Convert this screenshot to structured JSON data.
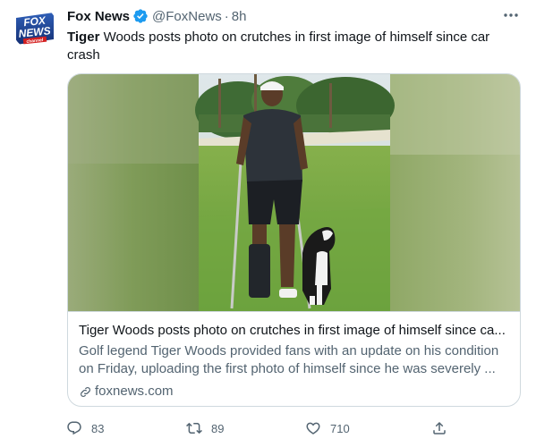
{
  "account": {
    "display_name": "Fox News",
    "handle": "@FoxNews",
    "separator": "·",
    "time": "8h",
    "avatar_text_line1": "FOX",
    "avatar_text_line2": "NEWS",
    "avatar_text_line3": "channel",
    "verified": true
  },
  "tweet": {
    "text_bold": "Tiger",
    "text_rest": " Woods posts photo on crutches in first image of himself since car crash"
  },
  "card": {
    "title": "Tiger Woods posts photo on crutches in first image of himself since ca...",
    "description": "Golf legend Tiger Woods provided fans with an update on his condition on Friday, uploading the first photo of himself since he was severely ...",
    "domain": "foxnews.com"
  },
  "actions": {
    "reply_count": "83",
    "retweet_count": "89",
    "like_count": "710"
  },
  "colors": {
    "text": "#0f1419",
    "secondary": "#536471",
    "verified": "#1d9bf0",
    "border": "#cfd9de",
    "fox_blue": "#1a3f8f",
    "fox_red": "#d42020"
  },
  "icons": [
    "fox-news-logo",
    "verified-badge-icon",
    "more-options-icon",
    "link-icon",
    "reply-icon",
    "retweet-icon",
    "like-icon",
    "share-icon"
  ]
}
